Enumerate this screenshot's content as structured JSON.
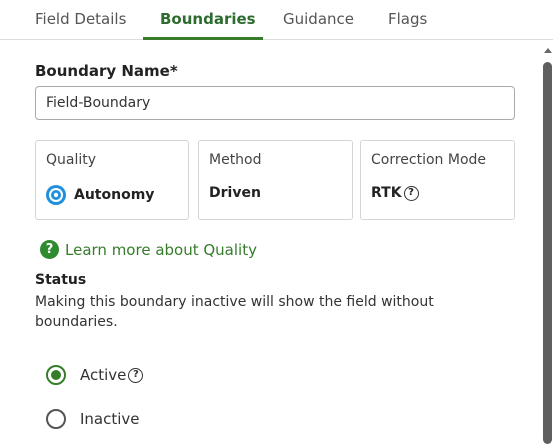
{
  "tabs": [
    {
      "label": "Field Details"
    },
    {
      "label": "Boundaries"
    },
    {
      "label": "Guidance"
    },
    {
      "label": "Flags"
    }
  ],
  "active_tab": "Boundaries",
  "boundary": {
    "name_label": "Boundary Name*",
    "name_value": "Field-Boundary"
  },
  "cards": {
    "quality": {
      "title": "Quality",
      "value": "Autonomy",
      "icon": "autonomy-icon"
    },
    "method": {
      "title": "Method",
      "value": "Driven"
    },
    "correction": {
      "title": "Correction Mode",
      "value": "RTK",
      "icon": "help-icon"
    }
  },
  "learn_more": {
    "label": "Learn more about Quality",
    "icon": "help-icon"
  },
  "status": {
    "label": "Status",
    "description": "Making this boundary inactive will show the field without boundaries.",
    "options": [
      {
        "label": "Active",
        "selected": true
      },
      {
        "label": "Inactive",
        "selected": false
      }
    ]
  },
  "colors": {
    "accent": "#367c2b"
  }
}
